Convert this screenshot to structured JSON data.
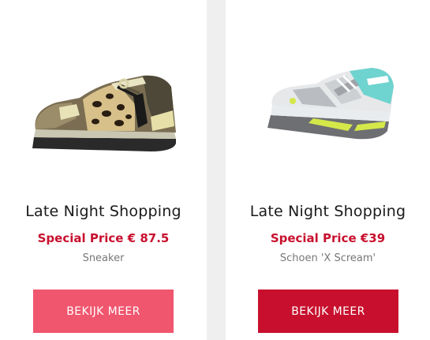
{
  "products": [
    {
      "title": "Late Night Shopping",
      "price": "Special Price € 87.5",
      "subtitle": "Sneaker",
      "button_label": "BEKIJK MEER",
      "button_color": "#f0566e",
      "image_icon": "leopard-sneaker-image"
    },
    {
      "title": "Late Night Shopping",
      "price": "Special Price €39",
      "subtitle": "Schoen 'X Scream'",
      "button_label": "BEKIJK MEER",
      "button_color": "#c8102e",
      "image_icon": "running-shoe-image"
    }
  ],
  "colors": {
    "price": "#c8102e",
    "background": "#efefef",
    "card": "#ffffff"
  }
}
